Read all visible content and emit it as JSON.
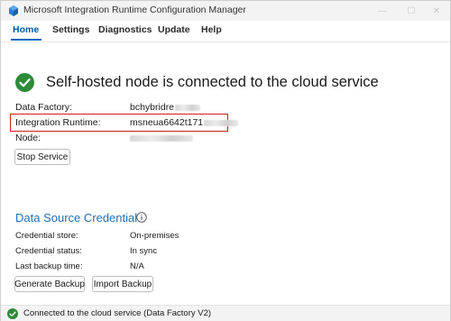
{
  "window": {
    "title": "Microsoft Integration Runtime Configuration Manager",
    "controls": {
      "minimize": "—",
      "maximize": "☐",
      "close": "✕"
    }
  },
  "tabs": [
    {
      "label": "Home",
      "active": true
    },
    {
      "label": "Settings",
      "active": false
    },
    {
      "label": "Diagnostics",
      "active": false
    },
    {
      "label": "Update",
      "active": false
    },
    {
      "label": "Help",
      "active": false
    }
  ],
  "status": {
    "headline": "Self-hosted node is connected to the cloud service",
    "icon": "check-circle-icon",
    "color": "#2e8b3a"
  },
  "details": {
    "data_factory_label": "Data Factory:",
    "data_factory_value": "bchybridre",
    "integration_runtime_label": "Integration Runtime:",
    "integration_runtime_value": "msneua6642t171",
    "node_label": "Node:",
    "node_value": ""
  },
  "buttons": {
    "stop_service": "Stop Service",
    "generate_backup": "Generate Backup",
    "import_backup": "Import Backup"
  },
  "credential": {
    "section_title": "Data Source Credential",
    "store_label": "Credential store:",
    "store_value": "On-premises",
    "status_label": "Credential status:",
    "status_value": "In sync",
    "backup_label": "Last backup time:",
    "backup_value": "N/A"
  },
  "statusbar": {
    "text": "Connected to the cloud service (Data Factory V2)"
  },
  "colors": {
    "accent": "#0067c0",
    "section_title": "#1d6fb8",
    "success": "#2e8b3a",
    "highlight_border": "#d01c1c"
  }
}
